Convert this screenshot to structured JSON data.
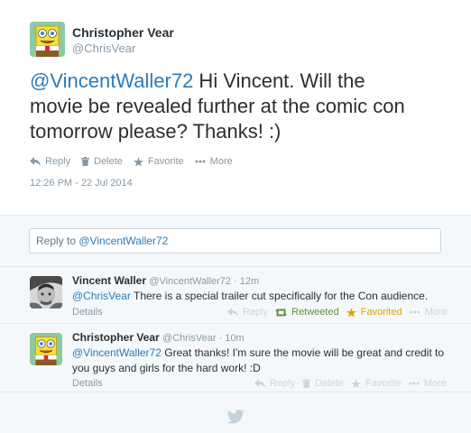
{
  "main_tweet": {
    "fullname": "Christopher Vear",
    "handle": "@ChrisVear",
    "mention": "@VincentWaller72",
    "text_line1_rest": " Hi Vincent. Will the",
    "text_line2": "movie be revealed further at the comic con",
    "text_line3": "tomorrow please? Thanks! :)",
    "actions": {
      "reply": "Reply",
      "delete": "Delete",
      "favorite": "Favorite",
      "more": "More"
    },
    "timestamp": "12:26 PM - 22 Jul 2014"
  },
  "reply_box": {
    "prefix": "Reply to ",
    "mention": "@VincentWaller72"
  },
  "replies": [
    {
      "fullname": "Vincent Waller",
      "meta": "@VincentWaller72 · 12m",
      "mention": "@ChrisVear",
      "text": " There is a special trailer cut specifically for the Con audience.",
      "details": "Details",
      "actions": {
        "reply": "Reply",
        "retweeted": "Retweeted",
        "favorited": "Favorited",
        "more": "More"
      }
    },
    {
      "fullname": "Christopher Vear",
      "meta": "@ChrisVear · 10m",
      "mention": "@VincentWaller72",
      "text_line1_rest": " Great thanks! I'm sure the movie will be great and credit to",
      "text_line2": "you guys and girls for the hard work! :D",
      "details": "Details",
      "actions": {
        "reply": "Reply",
        "delete": "Delete",
        "favorite": "Favorite",
        "more": "More"
      }
    }
  ],
  "colors": {
    "link": "#2b7bb9",
    "muted": "#8899a6",
    "retweet": "#5c913b",
    "favorite": "#e5a100",
    "reply_bg": "#f5f8fa"
  },
  "icons": [
    "spongebob-avatar",
    "person-avatar",
    "reply-icon",
    "trash-icon",
    "star-icon",
    "more-icon",
    "retweet-icon",
    "twitter-bird-icon"
  ]
}
